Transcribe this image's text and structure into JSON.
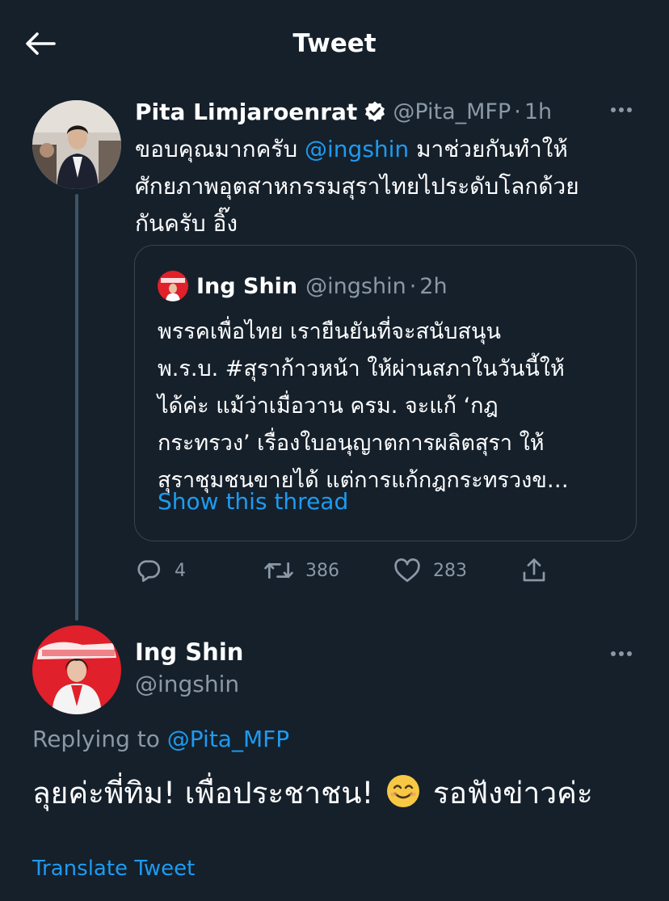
{
  "header": {
    "title": "Tweet"
  },
  "tweet": {
    "author": {
      "name": "Pita Limjaroenrat",
      "handle": "@Pita_MFP",
      "time": "1h"
    },
    "text": {
      "line1_pre": "ขอบคุณมากครับ ",
      "mention": "@ingshin",
      "line1_post": " มาช่วยกันทำให้",
      "line2": "ศักยภาพอุตสาหกรรมสุราไทยไประดับโลกด้วย",
      "line3": "กันครับ อิ๊ง"
    },
    "quote": {
      "author": {
        "name": "Ing Shin",
        "handle": "@ingshin",
        "time": "2h"
      },
      "lines": [
        "พรรคเพื่อไทย เรายืนยันที่จะสนับสนุน",
        "พ.ร.บ. #สุราก้าวหน้า ให้ผ่านสภาในวันนี้ให้",
        "ได้ค่ะ แม้ว่าเมื่อวาน ครม. จะแก้ ‘กฎ",
        "กระทรวง’ เรื่องใบอนุญาตการผลิตสุรา ให้",
        "สุราชุมชนขายได้ แต่การแก้กฎกระทรวงข…"
      ],
      "show_thread": "Show this thread"
    },
    "stats": {
      "replies": "4",
      "retweets": "386",
      "likes": "283"
    }
  },
  "reply": {
    "author": {
      "name": "Ing Shin",
      "handle": "@ingshin"
    },
    "replying_label": "Replying to ",
    "replying_to": "@Pita_MFP",
    "text_part1": "ลุยค่ะพี่ทิม! เพื่อประชาชน!",
    "text_part2": "รอฟังข่าวค่ะ",
    "translate": "Translate Tweet"
  },
  "colors": {
    "background": "#15202b",
    "accent": "#1d9bf0",
    "secondary_text": "#8b98a5",
    "border": "#38444d",
    "brand_red": "#e0202a"
  }
}
